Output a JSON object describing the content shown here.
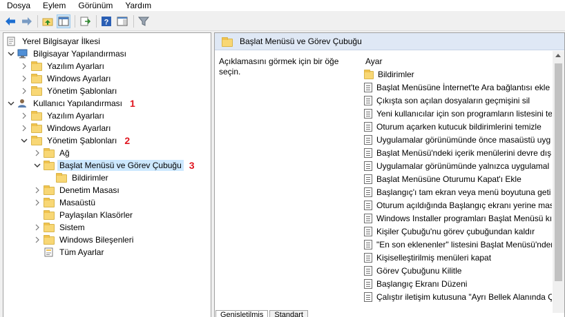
{
  "menu": [
    "Dosya",
    "Eylem",
    "Görünüm",
    "Yardım"
  ],
  "toolbar": {
    "icons": [
      "back-arrow-icon",
      "forward-arrow-icon",
      "up-folder-icon",
      "show-hide-tree-icon",
      "export-list-icon",
      "help-icon",
      "properties-pane-icon",
      "filter-icon"
    ]
  },
  "tree": {
    "root": "Yerel Bilgisayar İlkesi",
    "computer_config": "Bilgisayar Yapılandırması",
    "cc_software": "Yazılım Ayarları",
    "cc_windows": "Windows Ayarları",
    "cc_admin": "Yönetim Şablonları",
    "user_config": "Kullanıcı Yapılandırması",
    "uc_software": "Yazılım Ayarları",
    "uc_windows": "Windows Ayarları",
    "uc_admin": "Yönetim Şablonları",
    "network": "Ağ",
    "start_menu": "Başlat Menüsü ve Görev Çubuğu",
    "notifications": "Bildirimler",
    "control_panel": "Denetim Masası",
    "desktop": "Masaüstü",
    "shared_folders": "Paylaşılan Klasörler",
    "system": "Sistem",
    "windows_components": "Windows Bileşenleri",
    "all_settings": "Tüm Ayarlar",
    "markers": {
      "m1": "1",
      "m2": "2",
      "m3": "3"
    }
  },
  "detail": {
    "header": "Başlat Menüsü ve Görev Çubuğu",
    "description": "Açıklamasını görmek için bir öğe seçin.",
    "column": "Ayar",
    "folder_item": "Bildirimler",
    "settings": [
      "Başlat Menüsüne İnternet'te Ara bağlantısı ekle",
      "Çıkışta son açılan dosyaların geçmişini sil",
      "Yeni kullanıcılar için son programların listesini te",
      "Oturum açarken kutucuk bildirimlerini temizle",
      "Uygulamalar görünümünde önce masaüstü uyg",
      "Başlat Menüsü'ndeki içerik menülerini devre dış",
      "Uygulamalar görünümünde yalnızca uygulamal",
      "Başlat Menüsüne Oturumu Kapat'ı Ekle",
      "Başlangıç'ı tam ekran veya menü boyutuna geti",
      "Oturum açıldığında Başlangıç ekranı yerine mas",
      "Windows Installer programları Başlat Menüsü kı",
      "Kişiler Çubuğu'nu görev çubuğundan kaldır",
      "\"En son eklenenler\" listesini Başlat Menüsü'nder",
      "Kişiselleştirilmiş menüleri kapat",
      "Görev Çubuğunu Kilitle",
      "Başlangıç Ekranı Düzeni",
      "Çalıştır iletişim kutusuna \"Ayrı Bellek Alanında Ç"
    ]
  },
  "tabs": [
    "Genişletilmiş",
    "Standart"
  ],
  "colors": {
    "marker": "#e0141e",
    "selection": "#cce8ff",
    "header_bg": "#dfe8f5"
  }
}
